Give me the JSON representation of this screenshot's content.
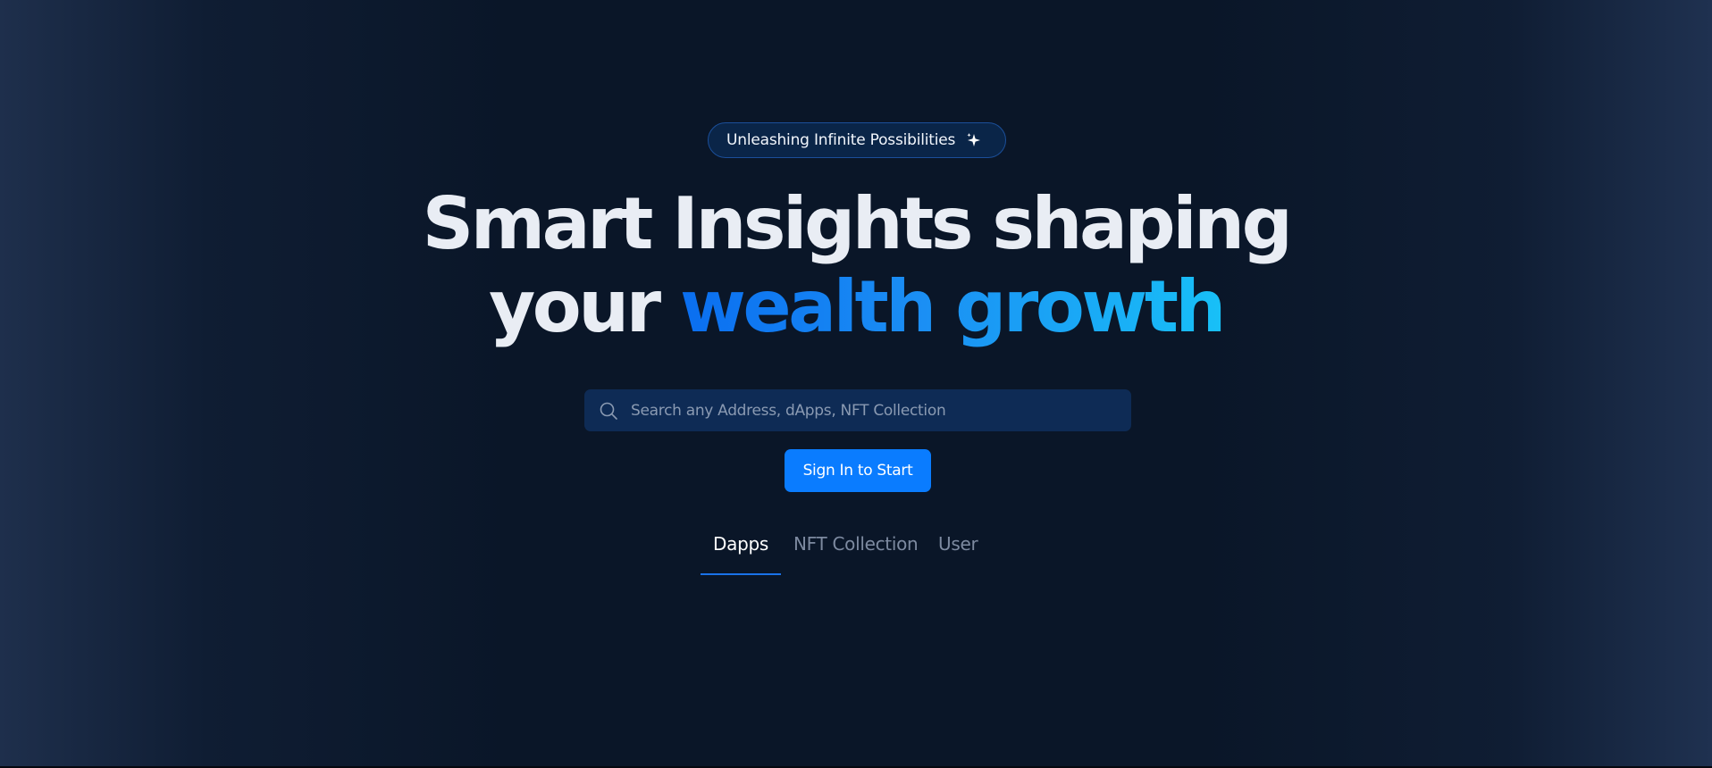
{
  "badge": {
    "label": "Unleashing Infinite Possibilities",
    "icon": "sparkle-icon"
  },
  "hero": {
    "line1": "Smart Insights shaping",
    "line2_plain": "your",
    "line2_highlight": "wealth growth"
  },
  "search": {
    "placeholder": "Search any Address, dApps, NFT Collection",
    "value": "",
    "icon": "search-icon"
  },
  "cta": {
    "label": "Sign In to Start"
  },
  "tabs": [
    {
      "label": "Dapps",
      "active": true
    },
    {
      "label": "NFT Collection",
      "active": false
    },
    {
      "label": "User",
      "active": false
    }
  ],
  "colors": {
    "accent": "#0a7cff",
    "highlight_start": "#0a6ef0",
    "highlight_end": "#18c0f7",
    "background": "#0a1628",
    "text": "#e9edf4"
  }
}
